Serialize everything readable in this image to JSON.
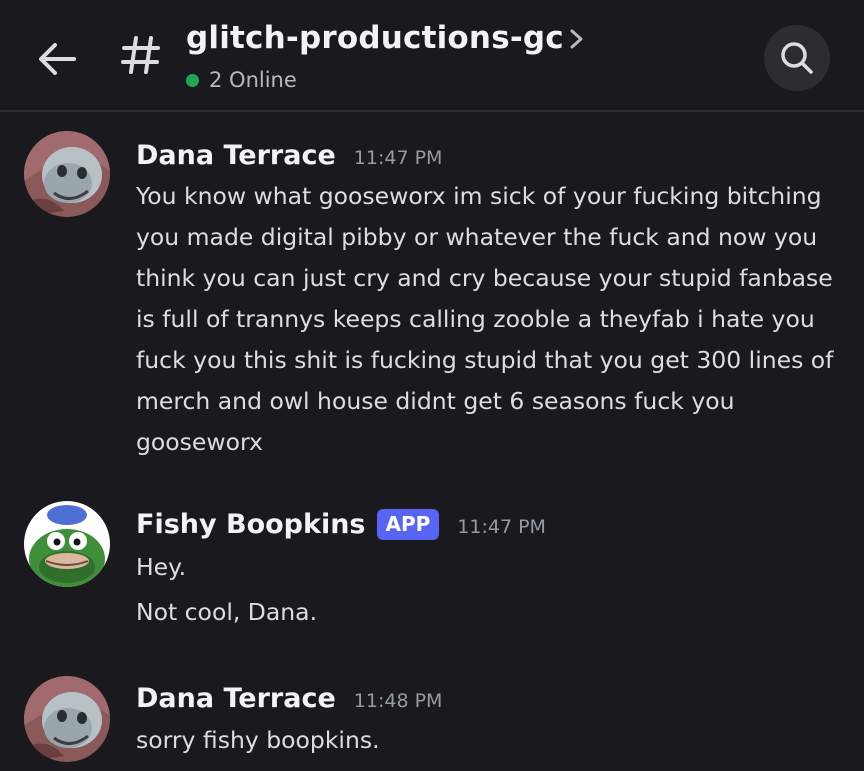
{
  "header": {
    "channel_name": "glitch-productions-gc",
    "online_count": "2 Online"
  },
  "icons": {
    "back": "arrow-left-icon",
    "channel": "hash-icon",
    "details": "chevron-right-icon",
    "search": "search-icon",
    "online_status_color": "#23a55a"
  },
  "messages": [
    {
      "author": "Dana Terrace",
      "time": "11:47 PM",
      "text": "You know what gooseworx im sick of your fucking bitching you made digital pibby or whatever the fuck and now you think you can just cry and cry because your stupid fanbase is full of trannys keeps calling zooble a theyfab i hate you fuck you this shit is fucking stupid that you get 300 lines of merch and owl house didnt get 6 seasons fuck you gooseworx"
    },
    {
      "author": "Fishy Boopkins",
      "badge": "APP",
      "time": "11:47 PM",
      "lines": [
        "Hey.",
        "Not cool, Dana."
      ]
    },
    {
      "author": "Dana Terrace",
      "time": "11:48 PM",
      "text": "sorry fishy boopkins."
    }
  ],
  "colors": {
    "background": "#1a1a1e",
    "badge": "#5865f2",
    "username": "#f2f3f5",
    "timestamp": "#949ba4"
  }
}
